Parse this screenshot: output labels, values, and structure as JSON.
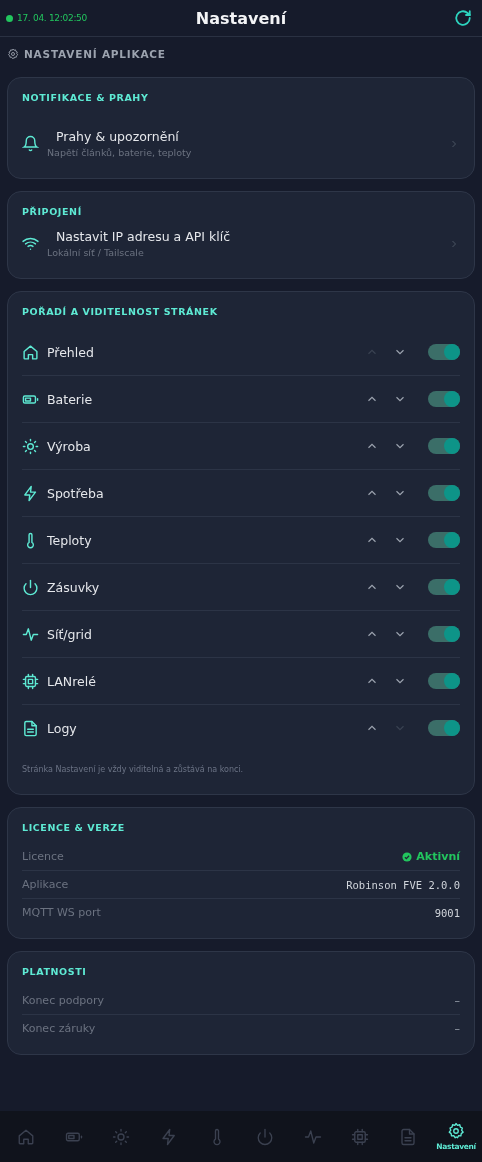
{
  "header": {
    "online": true,
    "time": "17. 04. 12:02:50",
    "title": "Nastavení"
  },
  "section_title": "NASTAVENÍ APLIKACE",
  "notifications": {
    "title": "NOTIFIKACE & PRAHY",
    "item": {
      "label": "Prahy & upozornění",
      "sublabel": "Napětí článků, baterie, teploty"
    }
  },
  "connection": {
    "title": "PŘIPOJENÍ",
    "item": {
      "label": "Nastavit IP adresu a API klíč",
      "sublabel": "Lokální síť / Tailscale"
    }
  },
  "pages": {
    "title": "POŘADÍ A VIDITELNOST STRÁNEK",
    "items": [
      {
        "label": "Přehled",
        "up_disabled": true,
        "down_disabled": false,
        "on": true
      },
      {
        "label": "Baterie",
        "up_disabled": false,
        "down_disabled": false,
        "on": true
      },
      {
        "label": "Výroba",
        "up_disabled": false,
        "down_disabled": false,
        "on": true
      },
      {
        "label": "Spotřeba",
        "up_disabled": false,
        "down_disabled": false,
        "on": true
      },
      {
        "label": "Teploty",
        "up_disabled": false,
        "down_disabled": false,
        "on": true
      },
      {
        "label": "Zásuvky",
        "up_disabled": false,
        "down_disabled": false,
        "on": true
      },
      {
        "label": "Síť/grid",
        "up_disabled": false,
        "down_disabled": false,
        "on": true
      },
      {
        "label": "LANrelé",
        "up_disabled": false,
        "down_disabled": false,
        "on": true
      },
      {
        "label": "Logy",
        "up_disabled": false,
        "down_disabled": true,
        "on": true
      }
    ],
    "note": "Stránka Nastavení je vždy viditelná a zůstává na konci."
  },
  "license": {
    "title": "LICENCE & VERZE",
    "rows": [
      {
        "kind": "status",
        "label": "Licence",
        "value": "Aktivní"
      },
      {
        "kind": "mono",
        "label": "Aplikace",
        "value": "Robinson FVE 2.0.0"
      },
      {
        "kind": "mono",
        "label": "MQTT WS port",
        "value": "9001"
      }
    ]
  },
  "validity": {
    "title": "PLATNOSTI",
    "rows": [
      {
        "kind": "plain",
        "label": "Konec podpory",
        "value": "–"
      },
      {
        "kind": "plain",
        "label": "Konec záruky",
        "value": "–"
      }
    ]
  },
  "nav": [
    {
      "selected": false
    },
    {
      "selected": false
    },
    {
      "selected": false
    },
    {
      "selected": false
    },
    {
      "selected": false
    },
    {
      "selected": false
    },
    {
      "selected": false
    },
    {
      "selected": false
    },
    {
      "selected": false
    },
    {
      "selected": true,
      "label": "Nastavení"
    }
  ]
}
